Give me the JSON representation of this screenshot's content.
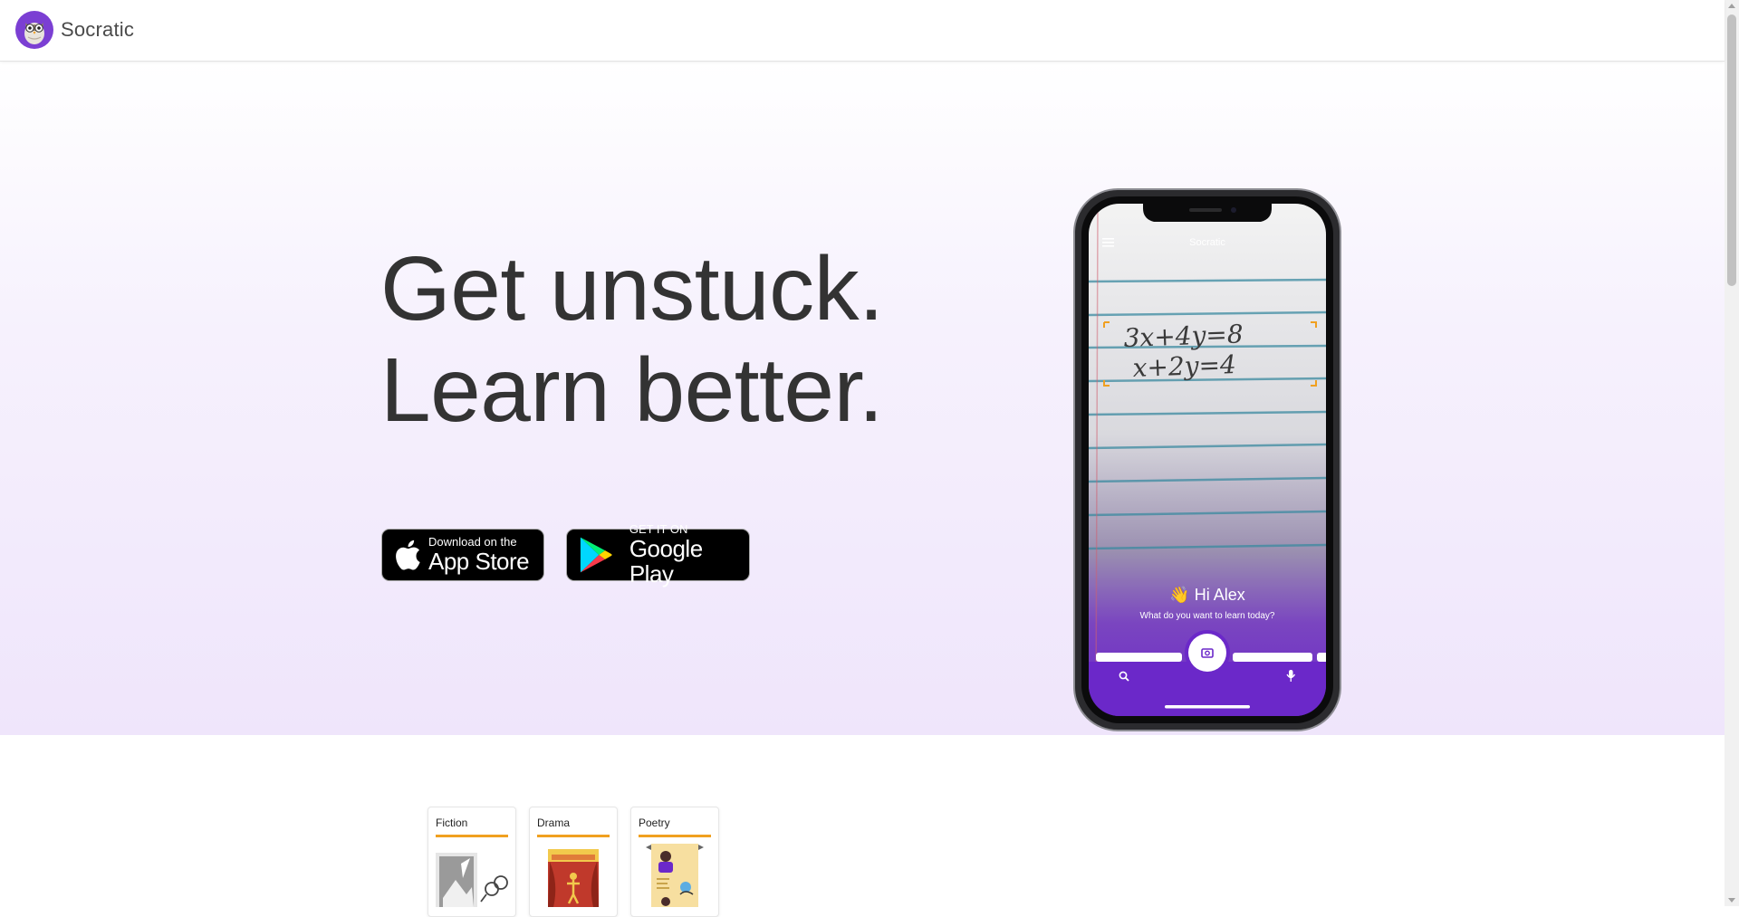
{
  "header": {
    "brand": "Socratic"
  },
  "hero": {
    "headline_line1": "Get unstuck.",
    "headline_line2": "Learn better.",
    "app_store": {
      "small": "Download on the",
      "big": "App Store"
    },
    "google_play": {
      "small": "GET IT ON",
      "big": "Google Play"
    }
  },
  "phone": {
    "app_title": "Socratic",
    "equation_line1": "3x+4y=8",
    "equation_line2": "x+2y=4",
    "greeting": "👋 Hi Alex",
    "prompt": "What do you want to learn today?"
  },
  "cards": [
    {
      "label": "Fiction"
    },
    {
      "label": "Drama"
    },
    {
      "label": "Poetry"
    }
  ],
  "colors": {
    "accent": "#6b28c9",
    "card_rule": "#f0a020",
    "headline": "#333333"
  }
}
